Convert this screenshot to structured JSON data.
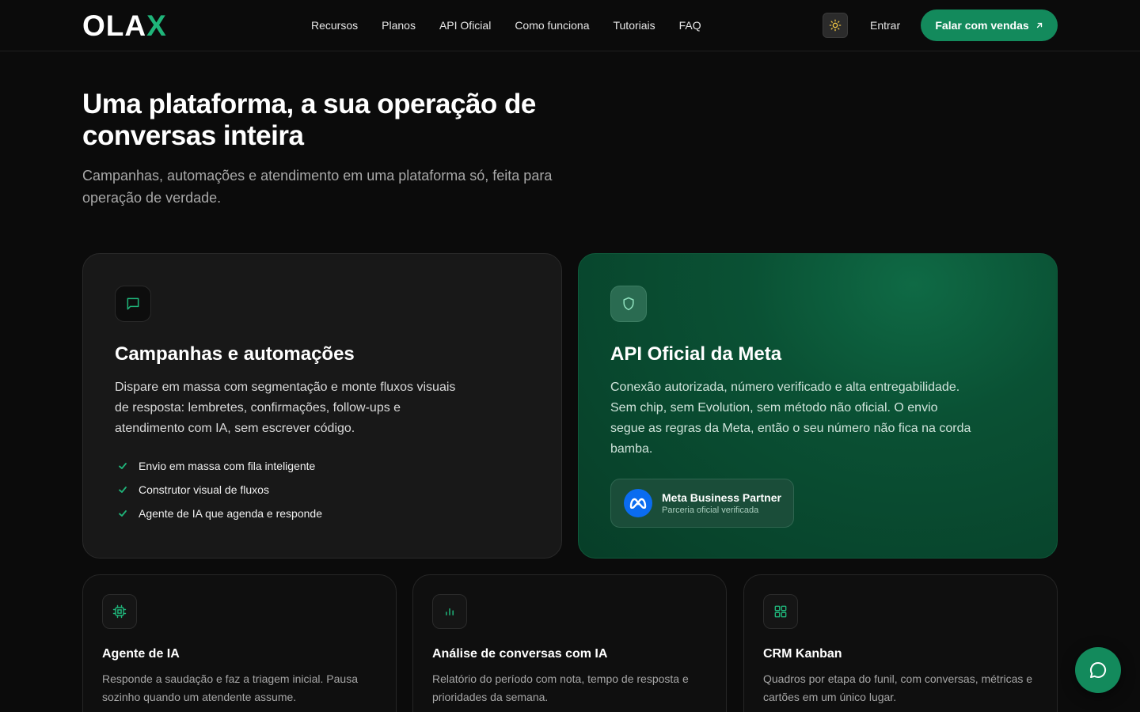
{
  "header": {
    "logo_main": "OLA",
    "logo_accent": "X",
    "nav": [
      "Recursos",
      "Planos",
      "API Oficial",
      "Como funciona",
      "Tutoriais",
      "FAQ"
    ],
    "login_label": "Entrar",
    "cta_label": "Falar com vendas"
  },
  "hero": {
    "title": "Uma plataforma, a sua operação de conversas inteira",
    "subtitle": "Campanhas, automações e atendimento em uma plataforma só, feita para operação de verdade."
  },
  "cards": {
    "campaigns": {
      "icon": "chat-bubble-icon",
      "title": "Campanhas e automações",
      "description": "Dispare em massa com segmentação e monte fluxos visuais de resposta: lembretes, confirmações, follow-ups e atendimento com IA, sem escrever código.",
      "features": [
        "Envio em massa com fila inteligente",
        "Construtor visual de fluxos",
        "Agente de IA que agenda e responde"
      ]
    },
    "meta_api": {
      "icon": "shield-icon",
      "title": "API Oficial da Meta",
      "description": "Conexão autorizada, número verificado e alta entregabilidade. Sem chip, sem Evolution, sem método não oficial. O envio segue as regras da Meta, então o seu número não fica na corda bamba.",
      "badge_title": "Meta Business Partner",
      "badge_subtitle": "Parceria oficial verificada"
    }
  },
  "features": [
    {
      "icon": "cpu-chip-icon",
      "title": "Agente de IA",
      "description": "Responde a saudação e faz a triagem inicial. Pausa sozinho quando um atendente assume."
    },
    {
      "icon": "bar-chart-icon",
      "title": "Análise de conversas com IA",
      "description": "Relatório do período com nota, tempo de resposta e prioridades da semana."
    },
    {
      "icon": "grid-icon",
      "title": "CRM Kanban",
      "description": "Quadros por etapa do funil, com conversas, métricas e cartões em um único lugar."
    }
  ],
  "colors": {
    "accent": "#138a5c",
    "accent_text": "#1fb57a",
    "background": "#0b0b0b"
  }
}
